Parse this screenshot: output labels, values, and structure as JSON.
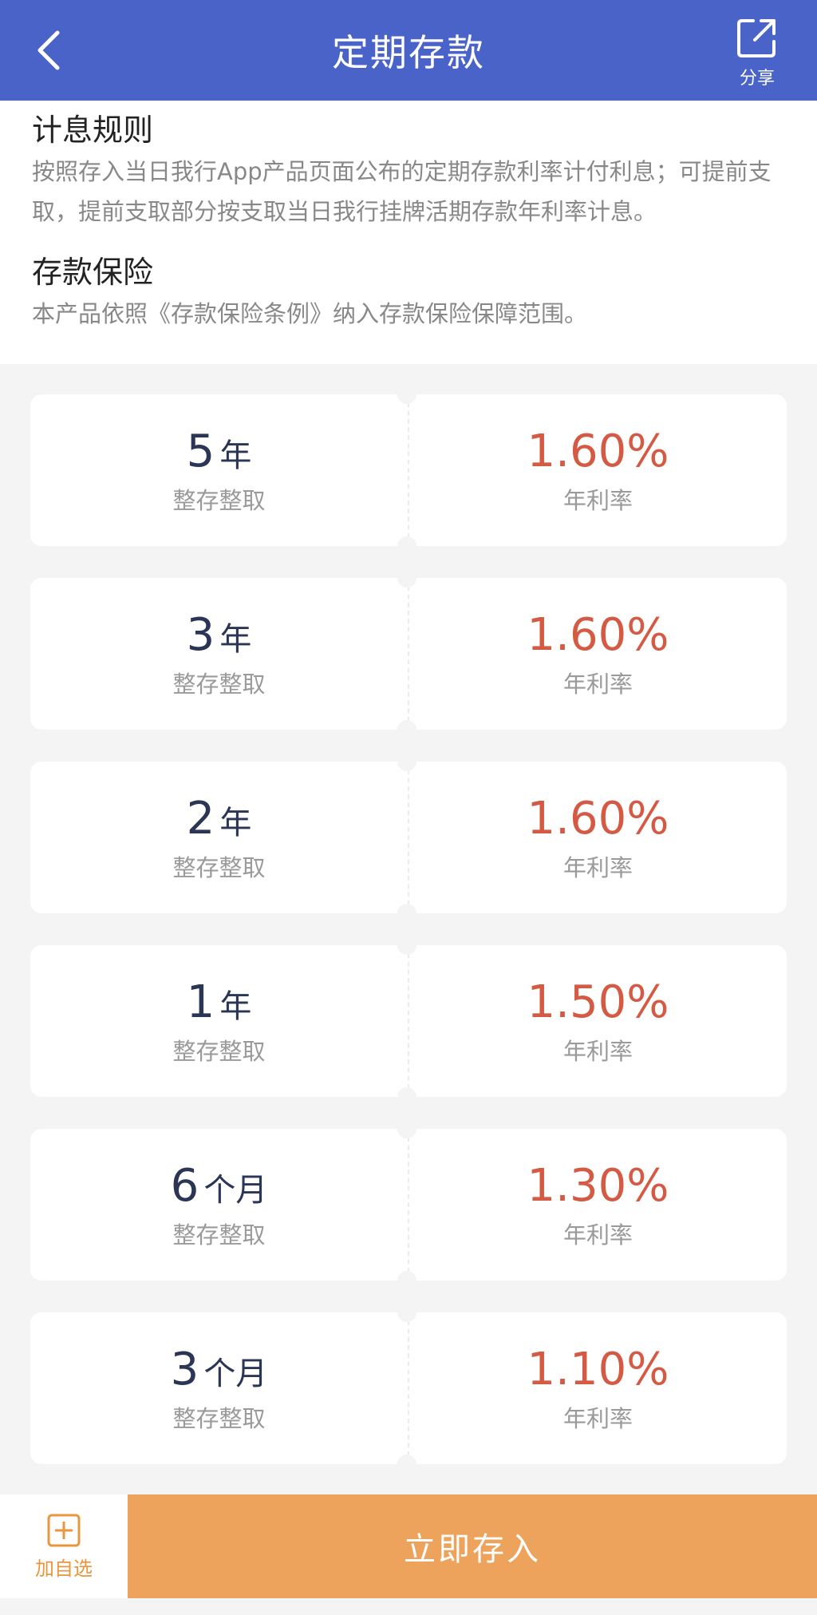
{
  "header": {
    "title": "定期存款",
    "share_label": "分享"
  },
  "info": {
    "rules_title": "计息规则",
    "rules_text": "按照存入当日我行App产品页面公布的定期存款利率计付利息；可提前支取，提前支取部分按支取当日我行挂牌活期存款年利率计息。",
    "insurance_title": "存款保险",
    "insurance_text": "本产品依照《存款保险条例》纳入存款保险保障范围。"
  },
  "products": [
    {
      "term_num": "5",
      "term_unit": "年",
      "type": "整存整取",
      "rate": "1.60%",
      "rate_label": "年利率"
    },
    {
      "term_num": "3",
      "term_unit": "年",
      "type": "整存整取",
      "rate": "1.60%",
      "rate_label": "年利率"
    },
    {
      "term_num": "2",
      "term_unit": "年",
      "type": "整存整取",
      "rate": "1.60%",
      "rate_label": "年利率"
    },
    {
      "term_num": "1",
      "term_unit": "年",
      "type": "整存整取",
      "rate": "1.50%",
      "rate_label": "年利率"
    },
    {
      "term_num": "6",
      "term_unit": "个月",
      "type": "整存整取",
      "rate": "1.30%",
      "rate_label": "年利率"
    },
    {
      "term_num": "3",
      "term_unit": "个月",
      "type": "整存整取",
      "rate": "1.10%",
      "rate_label": "年利率"
    }
  ],
  "footer": {
    "favorite_label": "加自选",
    "deposit_label": "立即存入"
  },
  "colors": {
    "header_bg": "#4a63c8",
    "rate": "#d45a44",
    "deposit_button": "#eea35c",
    "favorite": "#e9963e"
  }
}
